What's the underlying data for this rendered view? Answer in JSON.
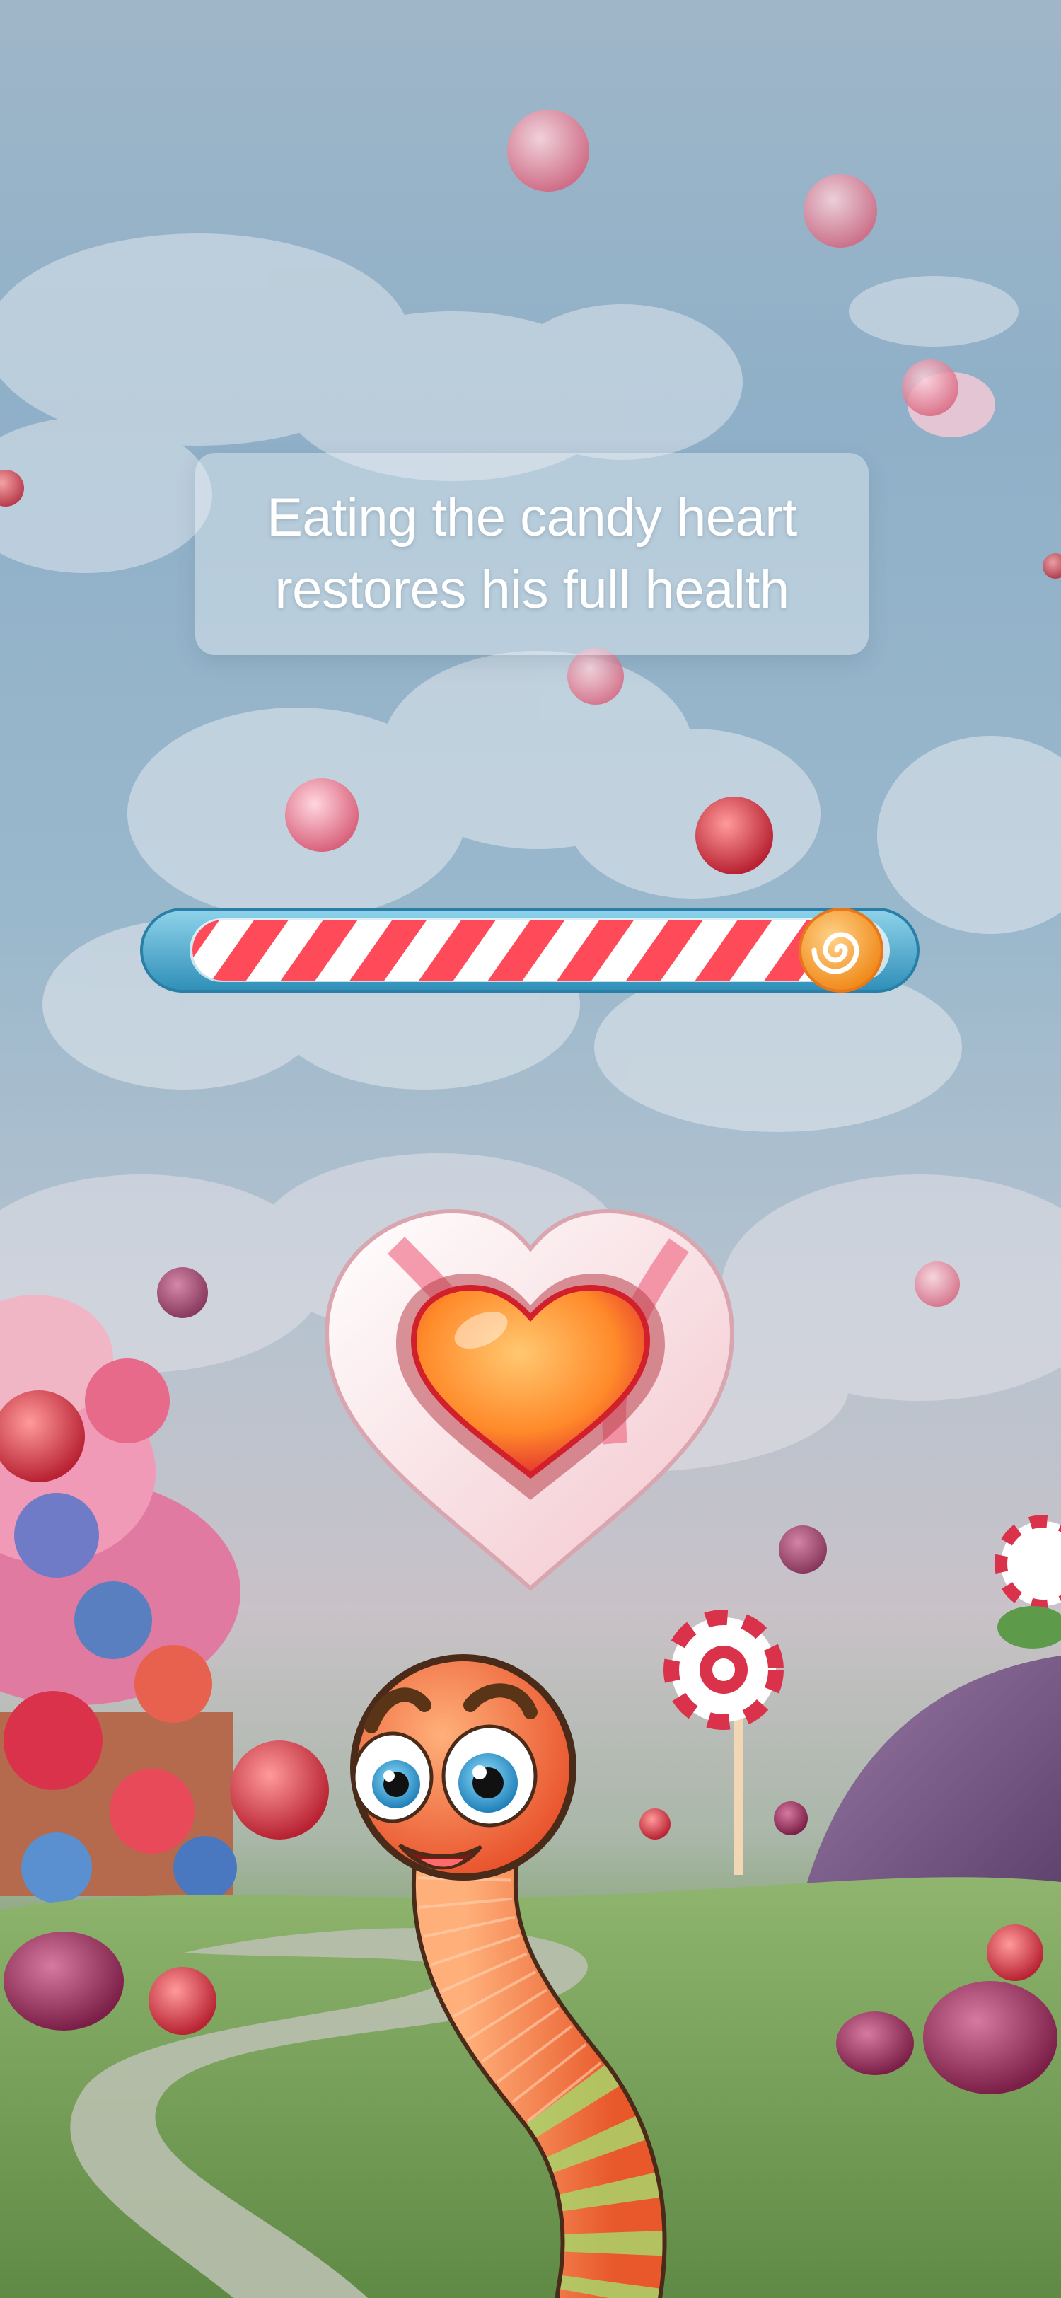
{
  "tooltip": {
    "text": "Eating the candy heart restores his full health"
  },
  "health_bar": {
    "level": 0.94,
    "knob_icon": "lollipop-swirl-icon",
    "stripe_colors": [
      "#ff4a5a",
      "#ffffff"
    ],
    "frame_color": "#3aa0c8"
  },
  "pickup": {
    "icon": "candy-heart-icon"
  },
  "player": {
    "icon": "worm-character"
  },
  "colors": {
    "sky": "#9fb6c8",
    "grass": "#6f9657",
    "accent": "#ff4a5a"
  }
}
